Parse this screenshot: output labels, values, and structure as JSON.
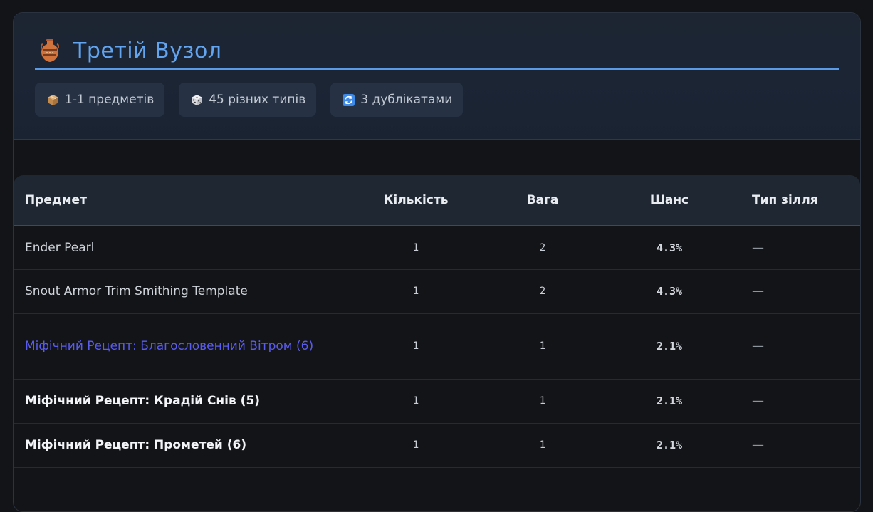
{
  "header": {
    "title": "Третій Вузол",
    "title_icon": "amphora-icon",
    "stats": [
      {
        "icon": "package-icon",
        "label": "1-1 предметів"
      },
      {
        "icon": "dice-icon",
        "label": "45 різних типів"
      },
      {
        "icon": "repeat-icon",
        "label": "3 дублікатами"
      }
    ]
  },
  "table": {
    "columns": [
      "Предмет",
      "Кількість",
      "Вага",
      "Шанс",
      "Тип зілля"
    ],
    "rows": [
      {
        "item": "Ender Pearl",
        "qty": "1",
        "weight": "2",
        "chance": "4.3%",
        "potion": "—",
        "style": "normal"
      },
      {
        "item": "Snout Armor Trim Smithing Template",
        "qty": "1",
        "weight": "2",
        "chance": "4.3%",
        "potion": "—",
        "style": "normal"
      },
      {
        "item": "Міфічний Рецепт: Благословенний Вітром (6)",
        "qty": "1",
        "weight": "1",
        "chance": "2.1%",
        "potion": "—",
        "style": "mythic"
      },
      {
        "item": "Міфічний Рецепт: Крадій Снів (5)",
        "qty": "1",
        "weight": "1",
        "chance": "2.1%",
        "potion": "—",
        "style": "bold"
      },
      {
        "item": "Міфічний Рецепт: Прометей (6)",
        "qty": "1",
        "weight": "1",
        "chance": "2.1%",
        "potion": "—",
        "style": "bold"
      }
    ]
  },
  "colors": {
    "accent": "#62a4f0",
    "mythic": "#5a5cf0",
    "background": "#131417",
    "header_bg": "#1d2532"
  }
}
